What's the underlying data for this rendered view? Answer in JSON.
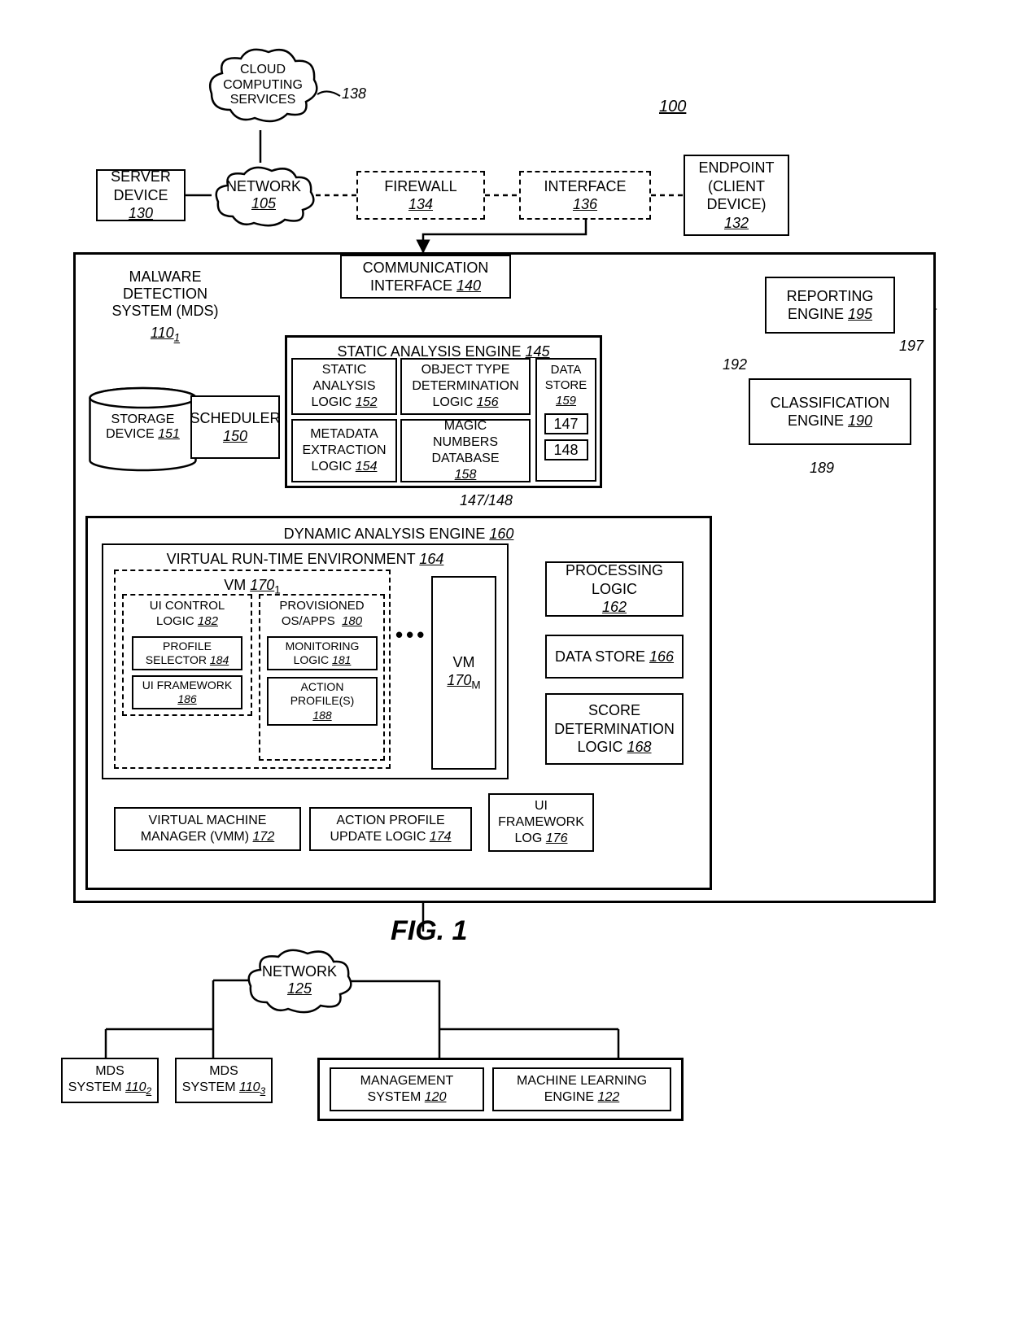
{
  "fig_label": "FIG. 1",
  "refs": {
    "system": "100",
    "cloud_services_ref": "138",
    "arrow189": "189",
    "arrow192": "192",
    "arrow197": "197",
    "sae_out": "147/148"
  },
  "top": {
    "cloud_services": {
      "line1": "CLOUD",
      "line2": "COMPUTING",
      "line3": "SERVICES"
    },
    "server": {
      "text": "SERVER DEVICE",
      "ref": "130"
    },
    "network": {
      "text": "NETWORK",
      "ref": "105"
    },
    "firewall": {
      "text": "FIREWALL",
      "ref": "134"
    },
    "interface": {
      "text": "INTERFACE",
      "ref": "136"
    },
    "endpoint": {
      "line1": "ENDPOINT",
      "line2": "(CLIENT",
      "line3": "DEVICE)",
      "ref": "132"
    }
  },
  "mds": {
    "label_line1": "MALWARE",
    "label_line2": "DETECTION",
    "label_line3": "SYSTEM (MDS)",
    "label_ref_num": "110",
    "label_ref_sub": "1",
    "comm_if": {
      "line1": "COMMUNICATION",
      "line2": "INTERFACE",
      "ref": "140"
    },
    "reporting": {
      "line1": "REPORTING",
      "line2": "ENGINE",
      "ref": "195"
    },
    "classification": {
      "line1": "CLASSIFICATION",
      "line2": "ENGINE",
      "ref": "190"
    },
    "storage": {
      "line1": "STORAGE",
      "line2": "DEVICE",
      "ref": "151"
    },
    "scheduler": {
      "text": "SCHEDULER",
      "ref": "150"
    }
  },
  "sae": {
    "title": "STATIC ANALYSIS ENGINE",
    "ref": "145",
    "sal": {
      "line1": "STATIC",
      "line2": "ANALYSIS",
      "line3": "LOGIC",
      "ref": "152"
    },
    "otd": {
      "line1": "OBJECT TYPE",
      "line2": "DETERMINATION",
      "line3": "LOGIC",
      "ref": "156"
    },
    "mel": {
      "line1": "METADATA",
      "line2": "EXTRACTION",
      "line3": "LOGIC",
      "ref": "154"
    },
    "mnd": {
      "line1": "MAGIC",
      "line2": "NUMBERS",
      "line3": "DATABASE",
      "ref": "158"
    },
    "ds": {
      "line1": "DATA",
      "line2": "STORE",
      "ref": "159",
      "inner1": "147",
      "inner2": "148"
    }
  },
  "dae": {
    "title": "DYNAMIC ANALYSIS ENGINE",
    "ref": "160",
    "vre": {
      "title": "VIRTUAL RUN-TIME ENVIRONMENT",
      "ref": "164"
    },
    "vm1": {
      "title": "VM",
      "ref_num": "170",
      "ref_sub": "1"
    },
    "vm1_inner": {
      "uicl": {
        "line1": "UI CONTROL",
        "line2": "LOGIC",
        "ref": "182"
      },
      "provisioned": {
        "line1": "PROVISIONED",
        "line2": "OS/APPS",
        "ref": "180"
      },
      "profile_sel": {
        "line1": "PROFILE",
        "line2": "SELECTOR",
        "ref": "184"
      },
      "monitoring": {
        "line1": "MONITORING",
        "line2": "LOGIC",
        "ref": "181"
      },
      "ui_fw": {
        "line1": "UI FRAMEWORK",
        "ref": "186"
      },
      "action_prof": {
        "line1": "ACTION",
        "line2": "PROFILE(S)",
        "ref": "188"
      }
    },
    "dots": "•••",
    "vmM": {
      "text": "VM",
      "ref_num": "170",
      "ref_sub": "M"
    },
    "vmm": {
      "line1": "VIRTUAL MACHINE",
      "line2": "MANAGER (VMM)",
      "ref": "172"
    },
    "apul": {
      "line1": "ACTION PROFILE",
      "line2": "UPDATE LOGIC",
      "ref": "174"
    },
    "uifl": {
      "line1": "UI",
      "line2": "FRAMEWORK",
      "line3": "LOG",
      "ref": "176"
    },
    "proc_logic": {
      "line1": "PROCESSING",
      "line2": "LOGIC",
      "ref": "162"
    },
    "data_store": {
      "text": "DATA STORE",
      "ref": "166"
    },
    "score": {
      "line1": "SCORE",
      "line2": "DETERMINATION",
      "line3": "LOGIC",
      "ref": "168"
    }
  },
  "bottom": {
    "network": {
      "text": "NETWORK",
      "ref": "125"
    },
    "mds2": {
      "line1": "MDS",
      "line2": "SYSTEM",
      "ref_num": "110",
      "ref_sub": "2"
    },
    "mds3": {
      "line1": "MDS",
      "line2": "SYSTEM",
      "ref_num": "110",
      "ref_sub": "3"
    },
    "mgmt": {
      "line1": "MANAGEMENT",
      "line2": "SYSTEM",
      "ref": "120"
    },
    "mle": {
      "line1": "MACHINE LEARNING",
      "line2": "ENGINE",
      "ref": "122"
    }
  }
}
